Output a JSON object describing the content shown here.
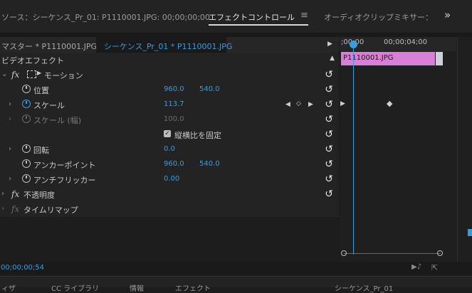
{
  "tabs": {
    "source": "ソース：シーケンス_Pr_01: P1110001.JPG: 00;00;00;00",
    "effect_controls": "エフェクトコントロール",
    "audio_mixer": "オーディオクリップミキサー：",
    "menu_icon": "≡",
    "overflow": "»"
  },
  "source_bar": {
    "master": "マスター * P1110001.JPG",
    "sequence": "シーケンス_Pr_01 * P1110001.JPG"
  },
  "section": {
    "video_effects": "ビデオエフェクト"
  },
  "effects": {
    "motion": "モーション",
    "position": {
      "label": "位置",
      "x": "960.0",
      "y": "540.0"
    },
    "scale": {
      "label": "スケール",
      "value": "113.7"
    },
    "scale_width": {
      "label": "スケール (幅)",
      "value": "100.0"
    },
    "uniform_scale": "縦横比を固定",
    "rotation": {
      "label": "回転",
      "value": "0.0"
    },
    "anchor": {
      "label": "アンカーポイント",
      "x": "960.0",
      "y": "540.0"
    },
    "antiflicker": {
      "label": "アンチフリッカー",
      "value": "0.00"
    },
    "opacity": "不透明度",
    "time_remap": "タイムリマップ"
  },
  "timeline": {
    "ruler_start": ";00;00",
    "ruler_mark": "00;00;04;00",
    "clip_name": "P1110001.JPG"
  },
  "footer": {
    "timecode": "00;00;00;54"
  },
  "bottom_tabs": [
    "ィザ",
    "CC ライブラリ",
    "情報",
    "エフェクト",
    "シーケンス_Pr_01"
  ],
  "colors": {
    "accent": "#3b9bdc",
    "clip": "#d87fd8"
  }
}
